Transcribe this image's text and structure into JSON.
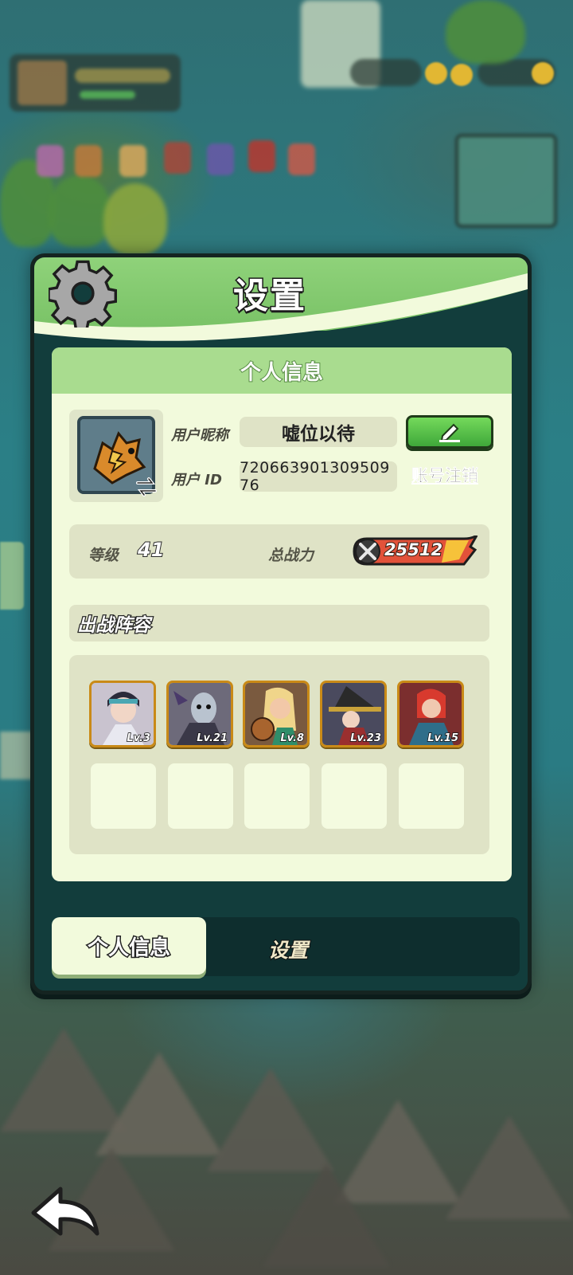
{
  "panel": {
    "title": "设置",
    "title_icon": "gear-icon"
  },
  "profile": {
    "section_title": "个人信息",
    "nickname_label": "用户昵称",
    "nickname_value": "嘘位以待",
    "id_label": "用户 ID",
    "id_value": "720663901309509​76",
    "edit_icon": "pencil-icon",
    "account_cancel_link": "账号注销",
    "avatar_swap_icon": "swap-arrows-icon"
  },
  "stats": {
    "level_label": "等级",
    "level_value": "41",
    "power_label": "总战力",
    "power_value": "25512",
    "power_icon": "crossed-swords-icon"
  },
  "lineup": {
    "title": "出战阵容",
    "heroes": [
      {
        "level": "Lv.3",
        "color": "#c9c3cf"
      },
      {
        "level": "Lv.21",
        "color": "#6d6a7a"
      },
      {
        "level": "Lv.8",
        "color": "#7a5a3f"
      },
      {
        "level": "Lv.23",
        "color": "#4a4a5e"
      },
      {
        "level": "Lv.15",
        "color": "#7b2e2e"
      }
    ],
    "empty_slots": 5
  },
  "tabs": [
    {
      "label": "个人信息",
      "active": true
    },
    {
      "label": "设置",
      "active": false
    }
  ],
  "nav": {
    "back_icon": "back-arrow-icon"
  },
  "colors": {
    "panel_green": "#8fd27a",
    "card_bg": "#f2fadc",
    "edit_button": "#4fc043",
    "hero_border": "#c98a17",
    "tabbar_bg": "#0e2e2e"
  }
}
